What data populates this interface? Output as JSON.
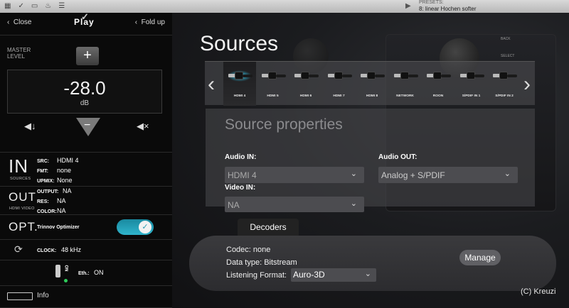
{
  "topbar": {
    "icons": [
      "menu-icon",
      "check-icon",
      "image-icon",
      "bell-icon",
      "list-icon"
    ],
    "presets_label": "PRESETS:",
    "presets_value": "8: linear Hochen softer"
  },
  "sidebar": {
    "close_label": "Close",
    "fold_label": "Fold up",
    "logo": "Play",
    "volume": {
      "label": "MASTER LEVEL",
      "plus": "+",
      "minus": "−",
      "value": "-28.0",
      "unit": "dB",
      "voldown_icon": "◀↓",
      "mute_icon": "◀×"
    },
    "inputs": {
      "big": "IN",
      "small": "SOURCES",
      "src_label": "SRC:",
      "src": "HDMI 4",
      "fmt_label": "FMT:",
      "fmt": "none",
      "upmix_label": "UPMIX:",
      "upmix": "None"
    },
    "outputs": {
      "big": "OUT",
      "small": "HDMI VIDEO",
      "output_label": "OUTPUT:",
      "output": "NA",
      "res_label": "RES:",
      "res": "NA",
      "color_label": "COLOR:",
      "color": "NA"
    },
    "optimizer": {
      "big": "OPT.",
      "label": "Trinnov Optimizer",
      "enabled": true
    },
    "clock": {
      "label": "CLOCK:",
      "value": "48 kHz"
    },
    "ethernet": {
      "on_text": "ON",
      "label": "Eth.:",
      "value": "ON"
    },
    "info_label": "Info"
  },
  "main": {
    "title": "Sources",
    "hw_labels": [
      "BACK",
      "SELECT"
    ],
    "sources": [
      {
        "label": "HDMI 4",
        "active": true
      },
      {
        "label": "HDMI 5",
        "active": false
      },
      {
        "label": "HDMI 6",
        "active": false
      },
      {
        "label": "HDMI 7",
        "active": false
      },
      {
        "label": "HDMI 8",
        "active": false
      },
      {
        "label": "NETWORK",
        "active": false
      },
      {
        "label": "ROON",
        "active": false
      },
      {
        "label": "S/PDIF IN 1",
        "active": false
      },
      {
        "label": "S/PDIF IN 2",
        "active": false
      }
    ],
    "properties": {
      "heading": "Source properties",
      "audio_in_label": "Audio IN:",
      "audio_in_value": "HDMI 4",
      "audio_out_label": "Audio OUT:",
      "audio_out_value": "Analog + S/PDIF",
      "video_in_label": "Video IN:",
      "video_in_value": "NA"
    },
    "decoders": {
      "tab_label": "Decoders",
      "codec": "Codec: none",
      "data_type": "Data type: Bitstream",
      "listening_label": "Listening Format:",
      "listening_value": "Auro-3D",
      "manage_label": "Manage"
    },
    "copyright": "(C) Kreuzi"
  },
  "colors": {
    "accent": "#2aa8c0",
    "panel": "#46464a",
    "sidebar": "#0a0a0a"
  }
}
